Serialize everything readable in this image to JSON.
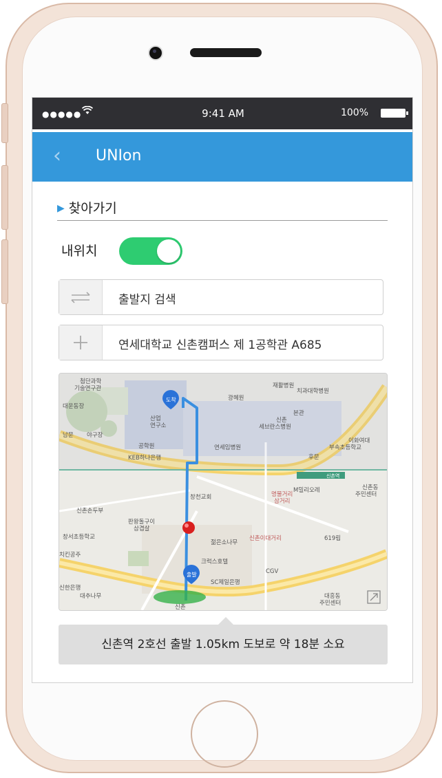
{
  "status_bar": {
    "signal": "●●●●●",
    "wifi_icon": "wifi-icon",
    "time": "9:41 AM",
    "battery": "100%"
  },
  "nav": {
    "title": "UNIon",
    "back_icon": "chevron-left-icon"
  },
  "section": {
    "title": "찾아가기"
  },
  "location_toggle": {
    "label": "내위치",
    "state": "on",
    "color": "#2ecc71"
  },
  "origin": {
    "icon": "swap-arrows-icon",
    "placeholder": "출발지 검색"
  },
  "destination": {
    "icon": "plus-icon",
    "value": "연세대학교 신촌캠퍼스 제 1공학관 A685"
  },
  "map": {
    "labels": [
      "첨단과학 기술연구관",
      "재활병원",
      "치과대학병원",
      "광혜원",
      "대운동장",
      "산업 연구소",
      "신촌 세브란스병원",
      "본관",
      "남문",
      "야구장",
      "공학원",
      "연세임병원",
      "이화여대 부속초등학교",
      "KEB하나은행",
      "후문",
      "창천교회",
      "명물거리 삼거리",
      "M밀리오레",
      "신촌동 주민센터",
      "신촌손두부",
      "판왕돌구이 삼겹살",
      "창서초등학교",
      "젊은소나무",
      "신촌이대거리",
      "619립",
      "치킨공주",
      "크럭스호텔",
      "CGV",
      "신한은행",
      "대추나무",
      "SC제일은행",
      "대흥동 주민센터",
      "신촌",
      "신촌역"
    ],
    "markers": {
      "arrival": "도착",
      "departure": "출발"
    },
    "route_color": "#3a8fe0",
    "expand_icon": "expand-icon"
  },
  "caption": "신촌역 2호선 출발 1.05km 도보로 약 18분 소요"
}
